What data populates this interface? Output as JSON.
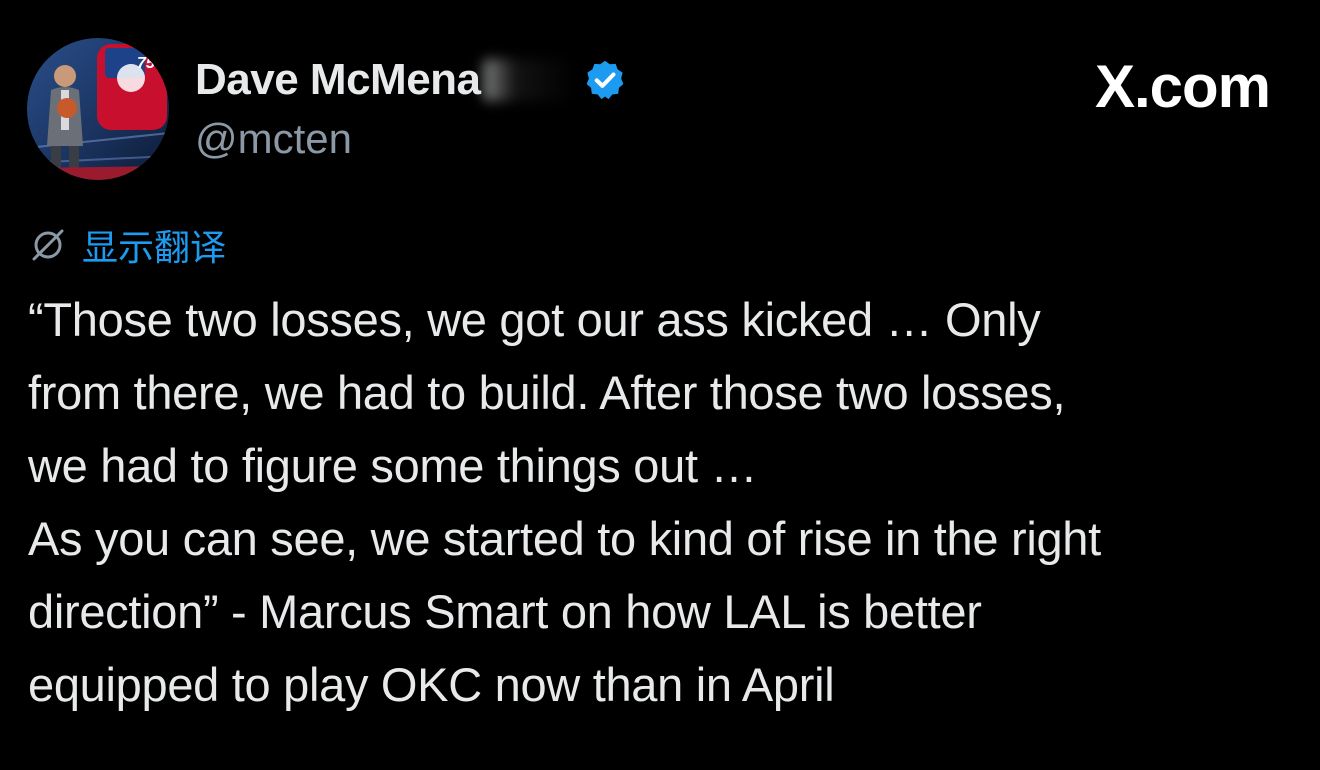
{
  "author": {
    "name": "Dave McMena",
    "handle": "@mcten",
    "verified": true
  },
  "brand": {
    "label": "X.com"
  },
  "translate": {
    "label": "显示翻译",
    "icon": "translate-off-icon"
  },
  "tweet": {
    "lines": [
      "“Those two losses, we got our ass kicked … Only",
      "from there, we had to build. After those two losses,",
      "we had to figure some things out …",
      "As you can see, we started to kind of rise in the right",
      "direction” - Marcus Smart on how LAL is better",
      "equipped to play OKC now than in April"
    ]
  },
  "colors": {
    "background": "#000000",
    "text": "#e7e9ea",
    "secondary_text": "#8b98a5",
    "accent": "#1d9bf0"
  }
}
